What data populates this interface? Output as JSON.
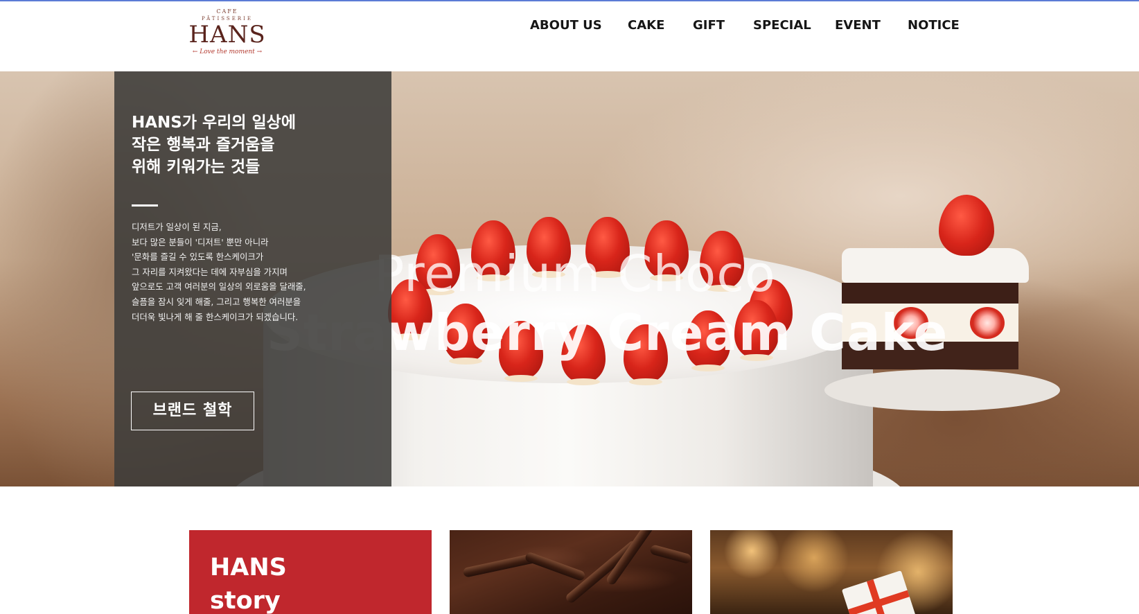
{
  "logo": {
    "cafe": "CAFE",
    "patisserie": "PÂTISSERIE",
    "name": "HANS",
    "tagline": "←  Love the moment  →"
  },
  "nav": {
    "items": [
      {
        "label": "ABOUT US"
      },
      {
        "label": "CAKE"
      },
      {
        "label": "GIFT"
      },
      {
        "label": "SPECIAL"
      },
      {
        "label": "EVENT"
      },
      {
        "label": "NOTICE"
      }
    ]
  },
  "hero": {
    "title_line1": "Premium Choco",
    "title_line2": "Strawberry Cream Cake"
  },
  "intro": {
    "heading": [
      "HANS가 우리의 일상에",
      "작은 행복과 즐거움을",
      "위해 키워가는 것들"
    ],
    "body": [
      "디저트가 일상이 된 지금,",
      "보다 많은 분들이 '디저트' 뿐만 아니라",
      "'문화를 즐길 수 있도록 한스케이크가",
      "그 자리를 지켜왔다는 데에 자부심을 가지며",
      "앞으로도 고객 여러분의 일상의 외로움을 달래줄,",
      "슬픔을 잠시 잊게 해줄, 그리고 행복한 여러분을",
      "더더욱 빛나게 해 줄 한스케이크가 되겠습니다."
    ],
    "button_label": "브랜드 철학"
  },
  "cards": {
    "story_title": [
      "HANS",
      "story"
    ]
  },
  "colors": {
    "accent_red": "#c0272d",
    "overlay": "#3e3c3a",
    "logo_brown": "#5a241d"
  }
}
